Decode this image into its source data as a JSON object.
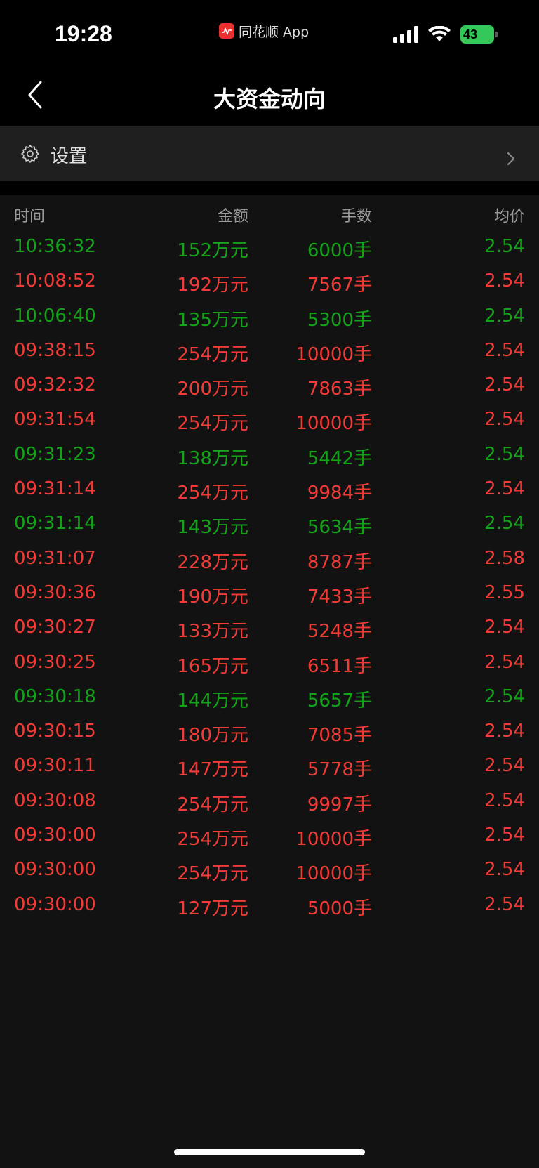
{
  "status_bar": {
    "time": "19:28",
    "app_name": "同花顺 App",
    "battery": "43"
  },
  "nav": {
    "title": "大资金动向"
  },
  "settings": {
    "label": "设置"
  },
  "colors": {
    "up": "#f23b36",
    "down": "#13a318",
    "background": "#121212"
  },
  "table": {
    "headers": [
      "时间",
      "金额",
      "手数",
      "均价"
    ],
    "rows": [
      {
        "time": "10:36:32",
        "amount": "152万元",
        "shares": "6000手",
        "price": "2.54",
        "direction": "down"
      },
      {
        "time": "10:08:52",
        "amount": "192万元",
        "shares": "7567手",
        "price": "2.54",
        "direction": "up"
      },
      {
        "time": "10:06:40",
        "amount": "135万元",
        "shares": "5300手",
        "price": "2.54",
        "direction": "down"
      },
      {
        "time": "09:38:15",
        "amount": "254万元",
        "shares": "10000手",
        "price": "2.54",
        "direction": "up"
      },
      {
        "time": "09:32:32",
        "amount": "200万元",
        "shares": "7863手",
        "price": "2.54",
        "direction": "up"
      },
      {
        "time": "09:31:54",
        "amount": "254万元",
        "shares": "10000手",
        "price": "2.54",
        "direction": "up"
      },
      {
        "time": "09:31:23",
        "amount": "138万元",
        "shares": "5442手",
        "price": "2.54",
        "direction": "down"
      },
      {
        "time": "09:31:14",
        "amount": "254万元",
        "shares": "9984手",
        "price": "2.54",
        "direction": "up"
      },
      {
        "time": "09:31:14",
        "amount": "143万元",
        "shares": "5634手",
        "price": "2.54",
        "direction": "down"
      },
      {
        "time": "09:31:07",
        "amount": "228万元",
        "shares": "8787手",
        "price": "2.58",
        "direction": "up"
      },
      {
        "time": "09:30:36",
        "amount": "190万元",
        "shares": "7433手",
        "price": "2.55",
        "direction": "up"
      },
      {
        "time": "09:30:27",
        "amount": "133万元",
        "shares": "5248手",
        "price": "2.54",
        "direction": "up"
      },
      {
        "time": "09:30:25",
        "amount": "165万元",
        "shares": "6511手",
        "price": "2.54",
        "direction": "up"
      },
      {
        "time": "09:30:18",
        "amount": "144万元",
        "shares": "5657手",
        "price": "2.54",
        "direction": "down"
      },
      {
        "time": "09:30:15",
        "amount": "180万元",
        "shares": "7085手",
        "price": "2.54",
        "direction": "up"
      },
      {
        "time": "09:30:11",
        "amount": "147万元",
        "shares": "5778手",
        "price": "2.54",
        "direction": "up"
      },
      {
        "time": "09:30:08",
        "amount": "254万元",
        "shares": "9997手",
        "price": "2.54",
        "direction": "up"
      },
      {
        "time": "09:30:00",
        "amount": "254万元",
        "shares": "10000手",
        "price": "2.54",
        "direction": "up"
      },
      {
        "time": "09:30:00",
        "amount": "254万元",
        "shares": "10000手",
        "price": "2.54",
        "direction": "up"
      },
      {
        "time": "09:30:00",
        "amount": "127万元",
        "shares": "5000手",
        "price": "2.54",
        "direction": "up"
      }
    ]
  }
}
